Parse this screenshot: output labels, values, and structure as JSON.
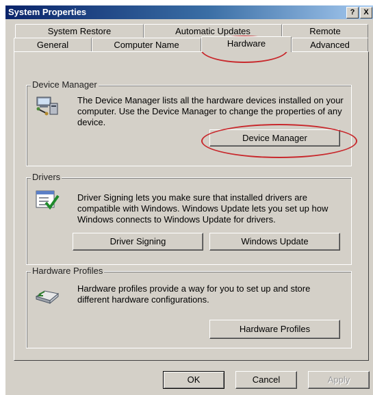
{
  "window": {
    "title": "System Properties",
    "help_label": "?",
    "close_label": "X"
  },
  "tabs": {
    "row_back": [
      {
        "label": "System Restore"
      },
      {
        "label": "Automatic Updates"
      },
      {
        "label": "Remote"
      }
    ],
    "row_front": [
      {
        "label": "General"
      },
      {
        "label": "Computer Name"
      },
      {
        "label": "Hardware",
        "active": true
      },
      {
        "label": "Advanced"
      }
    ]
  },
  "device_manager": {
    "legend": "Device Manager",
    "description": "The Device Manager lists all the hardware devices installed on your computer. Use the Device Manager to change the properties of any device.",
    "button_label": "Device Manager",
    "icon": "device-manager-icon"
  },
  "drivers": {
    "legend": "Drivers",
    "description": "Driver Signing lets you make sure that installed drivers are compatible with Windows. Windows Update lets you set up how Windows connects to Windows Update for drivers.",
    "driver_signing_label": "Driver Signing",
    "windows_update_label": "Windows Update",
    "icon": "driver-signing-icon"
  },
  "hardware_profiles": {
    "legend": "Hardware Profiles",
    "description": "Hardware profiles provide a way for you to set up and store different hardware configurations.",
    "button_label": "Hardware Profiles",
    "icon": "hardware-profiles-icon"
  },
  "footer": {
    "ok_label": "OK",
    "cancel_label": "Cancel",
    "apply_label": "Apply",
    "apply_disabled": true
  },
  "colors": {
    "dialog_face": "#d4d0c8",
    "title_bar": "#0a246a",
    "annotation": "#c8282c"
  }
}
